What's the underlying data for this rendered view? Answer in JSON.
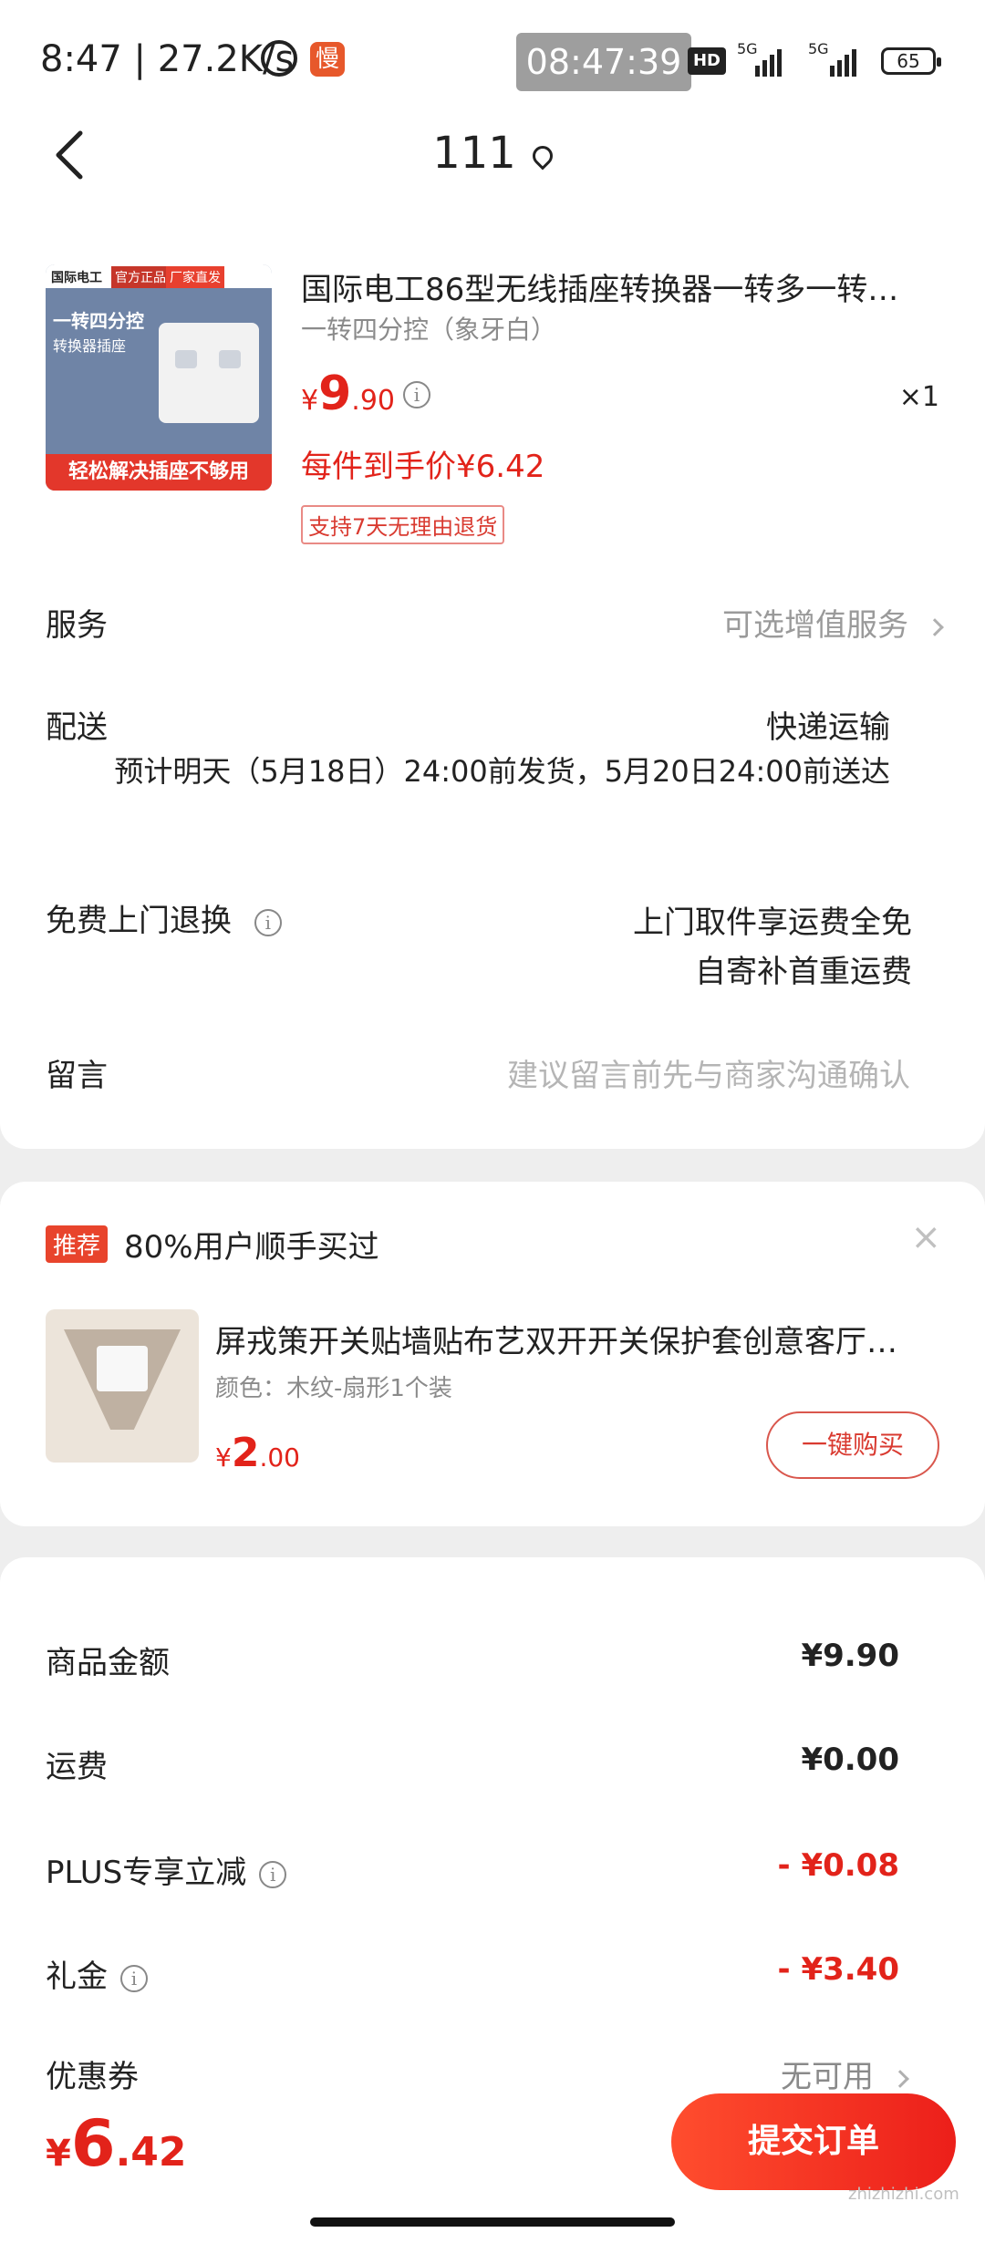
{
  "status_bar": {
    "time": "8:47",
    "speed": "27.2K/s",
    "slow_badge": "慢",
    "clock": "08:47:39",
    "hd": "HD",
    "net1": "5G",
    "net2": "5G",
    "battery": "65"
  },
  "header": {
    "title": "111"
  },
  "product": {
    "title": "国际电工86型无线插座转换器一转多一转…",
    "spec": "一转四分控（象牙白）",
    "price_currency": "¥",
    "price_int": "9",
    "price_dec": ".90",
    "qty": "×1",
    "per_price": "每件到手价¥6.42",
    "return_tag": "支持7天无理由退货",
    "image": {
      "brand": "国际电工",
      "tag1": "官方正品",
      "tag2": "厂家直发",
      "headline": "一转四分控",
      "subline": "转换器插座",
      "banner": "轻松解决插座不够用"
    }
  },
  "service": {
    "label": "服务",
    "value": "可选增值服务"
  },
  "delivery": {
    "label": "配送",
    "method": "快递运输",
    "eta": "预计明天（5月18日）24:00前发货，5月20日24:00前送达"
  },
  "free_return": {
    "label": "免费上门退换",
    "line1": "上门取件享运费全免",
    "line2": "自寄补首重运费"
  },
  "message": {
    "label": "留言",
    "placeholder": "建议留言前先与商家沟通确认"
  },
  "recommend": {
    "badge": "推荐",
    "title": "80%用户顺手买过",
    "close": "×",
    "item": {
      "name": "屏戎策开关贴墙贴布艺双开开关保护套创意客厅…",
      "spec": "颜色：木纹-扇形1个装",
      "price_currency": "¥",
      "price_int": "2",
      "price_dec": ".00",
      "button": "一键购买"
    }
  },
  "summary": {
    "goods_label": "商品金额",
    "goods_value": "¥9.90",
    "shipping_label": "运费",
    "shipping_value": "¥0.00",
    "plus_label": "PLUS专享立减",
    "plus_value": "- ¥0.08",
    "gift_label": "礼金",
    "gift_value": "- ¥3.40",
    "coupon_label": "优惠券",
    "coupon_value": "无可用"
  },
  "footer": {
    "total_currency": "¥",
    "total_int": "6",
    "total_dec": ".42",
    "submit": "提交订单",
    "watermark": "zhizhizhi.com"
  },
  "colors": {
    "accent": "#e2231a",
    "page_bg": "#eeeeee"
  }
}
